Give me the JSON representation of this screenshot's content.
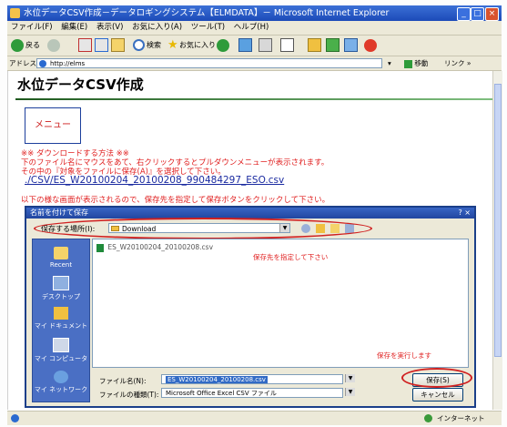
{
  "window": {
    "title": "水位データCSV作成－データロギングシステム【ELMDATA】－ Microsoft Internet Explorer",
    "controls": [
      "_",
      "□",
      "×"
    ]
  },
  "menubar": [
    "ファイル(F)",
    "編集(E)",
    "表示(V)",
    "お気に入り(A)",
    "ツール(T)",
    "ヘルプ(H)"
  ],
  "toolbar": {
    "back_label": "戻る",
    "search_label": "検索",
    "favorites_label": "お気に入り"
  },
  "addressbar": {
    "label": "アドレス(D)",
    "url": "http://elms",
    "go_label": "移動",
    "links_label": "リンク »"
  },
  "page": {
    "title": "水位データCSV作成",
    "menu_button": "メニュー",
    "instructions": [
      "※※ ダウンロードする方法 ※※",
      "下のファイル名にマウスをあて、右クリックするとプルダウンメニューが表示されます。",
      "その中の『対象をファイルに保存(A)』を選択して下さい。"
    ],
    "csv_link": "./CSV/ES_W20100204_20100208_990484297_ESO.csv",
    "dialog_note": "以下の様な画面が表示されるので、保存先を指定して保存ボタンをクリックして下さい。"
  },
  "dialog": {
    "title": "名前を付けて保存",
    "help_close": "? ×",
    "save_in_label": "保存する場所(I):",
    "save_in_value": "Download",
    "places": [
      "Recent",
      "デスクトップ",
      "マイ ドキュメント",
      "マイ コンピュータ",
      "マイ ネットワーク"
    ],
    "file_item": "ES_W20100204_20100208.csv",
    "annotation_location": "保存先を指定して下さい",
    "annotation_save": "保存を実行します",
    "filename_label": "ファイル名(N):",
    "filename_value": "ES_W20100204_20100208.csv",
    "filetype_label": "ファイルの種類(T):",
    "filetype_value": "Microsoft Office Excel CSV ファイル",
    "save_button": "保存(S)",
    "cancel_button": "キャンセル"
  },
  "statusbar": {
    "zone": "インターネット"
  },
  "colors": {
    "annotation_red": "#d02020",
    "titlebar_blue": "#1c4bb8",
    "link_blue": "#1a2aa0"
  }
}
